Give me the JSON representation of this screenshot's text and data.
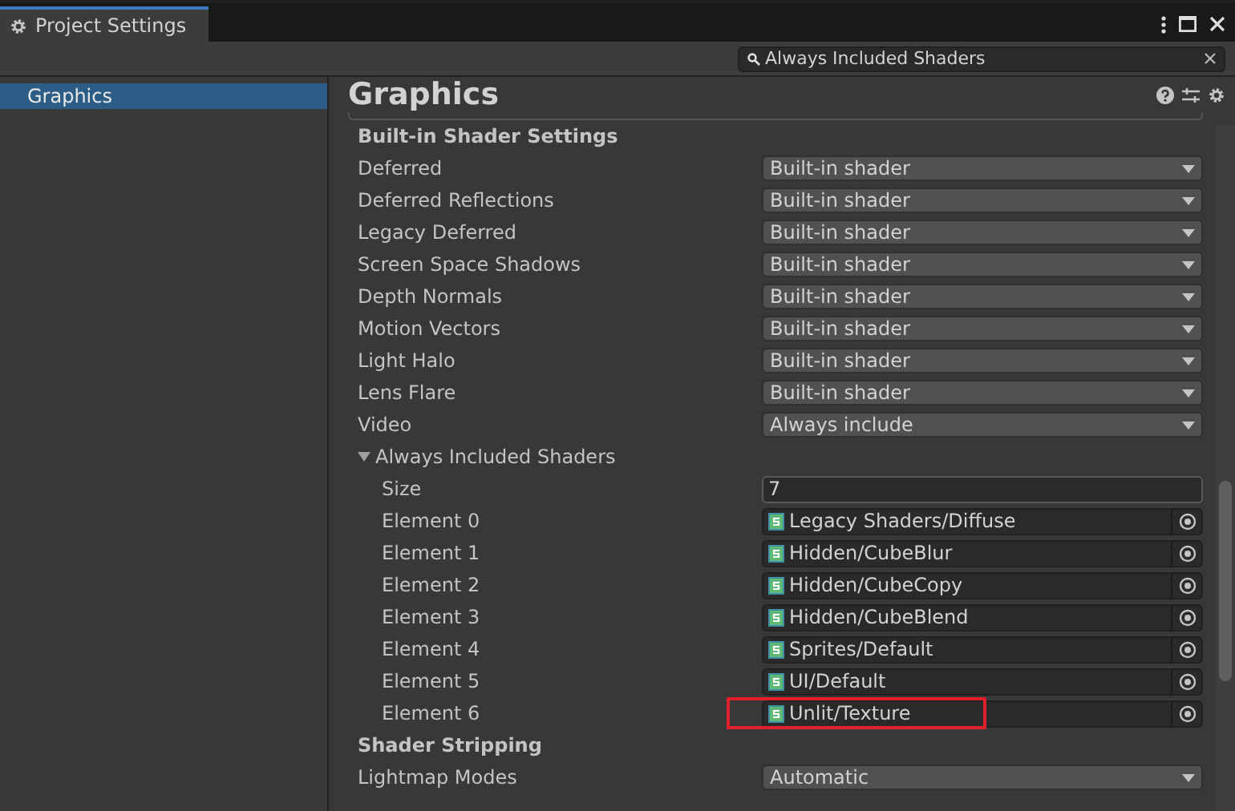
{
  "window": {
    "tab_title": "Project Settings"
  },
  "search": {
    "value": "Always Included Shaders"
  },
  "sidebar": {
    "items": [
      {
        "label": "Graphics",
        "selected": true
      }
    ]
  },
  "panel": {
    "title": "Graphics",
    "sections": [
      {
        "kind": "header",
        "label": "Built-in Shader Settings"
      },
      {
        "kind": "dropdown",
        "label": "Deferred",
        "value": "Built-in shader"
      },
      {
        "kind": "dropdown",
        "label": "Deferred Reflections",
        "value": "Built-in shader"
      },
      {
        "kind": "dropdown",
        "label": "Legacy Deferred",
        "value": "Built-in shader"
      },
      {
        "kind": "dropdown",
        "label": "Screen Space Shadows",
        "value": "Built-in shader"
      },
      {
        "kind": "dropdown",
        "label": "Depth Normals",
        "value": "Built-in shader"
      },
      {
        "kind": "dropdown",
        "label": "Motion Vectors",
        "value": "Built-in shader"
      },
      {
        "kind": "dropdown",
        "label": "Light Halo",
        "value": "Built-in shader"
      },
      {
        "kind": "dropdown",
        "label": "Lens Flare",
        "value": "Built-in shader"
      },
      {
        "kind": "dropdown",
        "label": "Video",
        "value": "Always include"
      },
      {
        "kind": "foldout",
        "label": "Always Included Shaders",
        "expanded": true
      },
      {
        "kind": "number",
        "label": "Size",
        "value": "7"
      },
      {
        "kind": "object",
        "label": "Element 0",
        "value": "Legacy Shaders/Diffuse",
        "highlighted": false
      },
      {
        "kind": "object",
        "label": "Element 1",
        "value": "Hidden/CubeBlur",
        "highlighted": false
      },
      {
        "kind": "object",
        "label": "Element 2",
        "value": "Hidden/CubeCopy",
        "highlighted": false
      },
      {
        "kind": "object",
        "label": "Element 3",
        "value": "Hidden/CubeBlend",
        "highlighted": false
      },
      {
        "kind": "object",
        "label": "Element 4",
        "value": "Sprites/Default",
        "highlighted": false
      },
      {
        "kind": "object",
        "label": "Element 5",
        "value": "UI/Default",
        "highlighted": false
      },
      {
        "kind": "object",
        "label": "Element 6",
        "value": "Unlit/Texture",
        "highlighted": true
      },
      {
        "kind": "header",
        "label": "Shader Stripping"
      },
      {
        "kind": "dropdown",
        "label": "Lightmap Modes",
        "value": "Automatic"
      }
    ]
  }
}
